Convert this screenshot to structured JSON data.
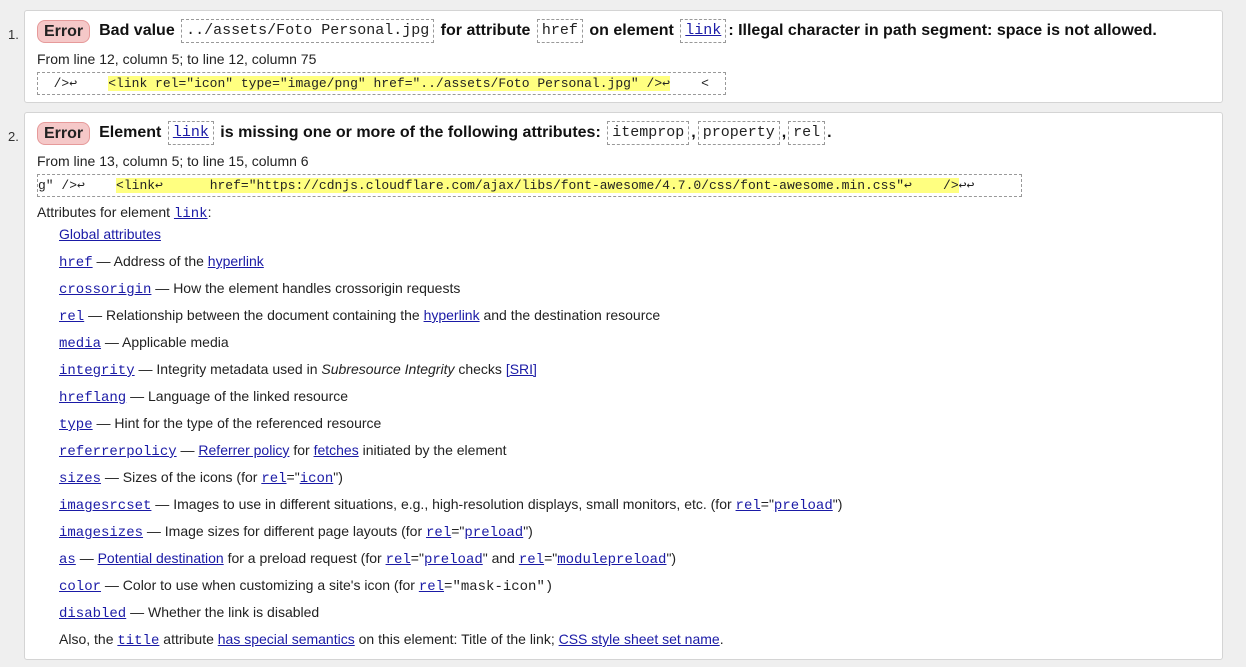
{
  "messages": [
    {
      "number": "1.",
      "badge": "Error",
      "head_pre": "Bad value",
      "value": "../assets/Foto Personal.jpg",
      "head_mid": "for attribute",
      "attr": "href",
      "head_mid2": "on element",
      "element": "link",
      "head_post": ": Illegal character in path segment: space is not allowed.",
      "location": "From line 12, column 5; to line 12, column 75",
      "extract_pre": "  />↩    ",
      "extract_hl": "<link rel=\"icon\" type=\"image/png\" href=\"../assets/Foto Personal.jpg\" />↩",
      "extract_post": "    <"
    },
    {
      "number": "2.",
      "badge": "Error",
      "head_pre": "Element",
      "element": "link",
      "head_mid": "is missing one or more of the following attributes:",
      "attrs": [
        "itemprop",
        "property",
        "rel"
      ],
      "location": "From line 13, column 5; to line 15, column 6",
      "extract_pre": "g\" />↩    ",
      "extract_hl": "<link↩      href=\"https://cdnjs.cloudflare.com/ajax/libs/font-awesome/4.7.0/css/font-awesome.min.css\"↩    />",
      "extract_post": "↩↩",
      "attributes_title_pre": "Attributes for element",
      "attributes_title_el": "link",
      "attributes_title_post": ":",
      "attribute_list": {
        "global": "Global attributes",
        "href": {
          "name": "href",
          "desc": " — Address of the ",
          "link": "hyperlink"
        },
        "crossorigin": {
          "name": "crossorigin",
          "desc": " — How the element handles crossorigin requests"
        },
        "rel": {
          "name": "rel",
          "desc": " — Relationship between the document containing the ",
          "link": "hyperlink",
          "post": " and the destination resource"
        },
        "media": {
          "name": "media",
          "desc": " — Applicable media"
        },
        "integrity": {
          "name": "integrity",
          "desc": " — Integrity metadata used in ",
          "em": "Subresource Integrity",
          "post": " checks ",
          "link": "[SRI]"
        },
        "hreflang": {
          "name": "hreflang",
          "desc": " — Language of the linked resource"
        },
        "type": {
          "name": "type",
          "desc": " — Hint for the type of the referenced resource"
        },
        "referrerpolicy": {
          "name": "referrerpolicy",
          "desc": " — ",
          "link": "Referrer policy",
          "mid": " for ",
          "link2": "fetches",
          "post": " initiated by the element"
        },
        "sizes": {
          "name": "sizes",
          "desc": " — Sizes of the icons (for ",
          "rel": "rel",
          "eq": "=\"",
          "val": "icon",
          "post": "\")"
        },
        "imagesrcset": {
          "name": "imagesrcset",
          "desc": " — Images to use in different situations, e.g., high-resolution displays, small monitors, etc. (for ",
          "rel": "rel",
          "eq": "=\"",
          "val": "preload",
          "post": "\")"
        },
        "imagesizes": {
          "name": "imagesizes",
          "desc": " — Image sizes for different page layouts (for ",
          "rel": "rel",
          "eq": "=\"",
          "val": "preload",
          "post": "\")"
        },
        "as": {
          "name": "as",
          "desc": " — ",
          "link": "Potential destination",
          "mid": " for a preload request (for ",
          "rel": "rel",
          "eq": "=\"",
          "val": "preload",
          "mid2": "\" and ",
          "rel2": "rel",
          "eq2": "=\"",
          "val2": "modulepreload",
          "post": "\")"
        },
        "color": {
          "name": "color",
          "desc": " — Color to use when customizing a site's icon (for ",
          "rel": "rel",
          "eq": "=\"mask-icon\")"
        },
        "disabled": {
          "name": "disabled",
          "desc": " — Whether the link is disabled"
        },
        "also": {
          "pre": "Also, the ",
          "name": "title",
          "mid": " attribute ",
          "link": "has special semantics",
          "mid2": " on this element: Title of the link; ",
          "link2": "CSS style sheet set name",
          "post": "."
        }
      }
    }
  ]
}
